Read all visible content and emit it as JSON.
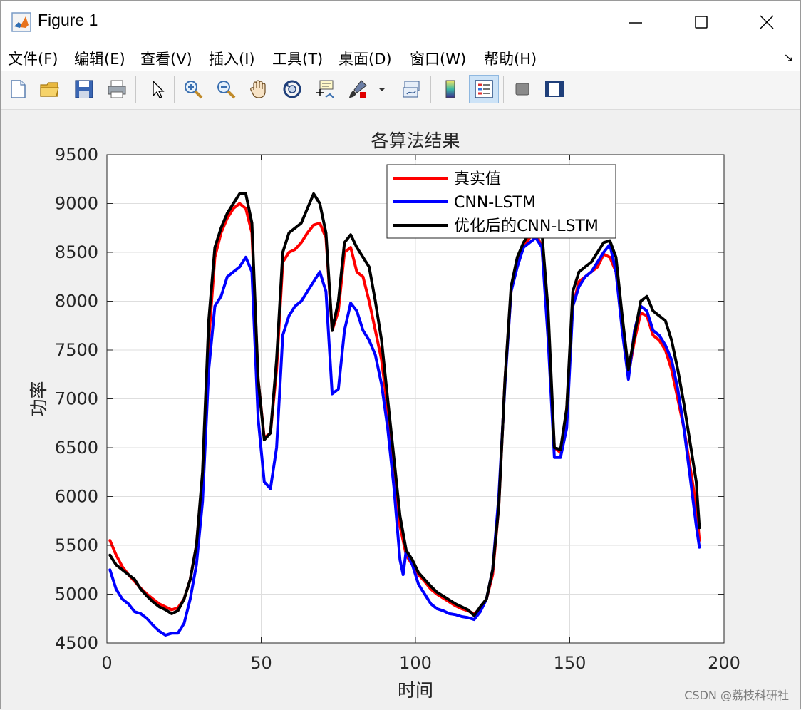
{
  "window": {
    "title": "Figure 1",
    "minimize_glyph": "—",
    "maximize_glyph": "☐",
    "close_glyph": "✕"
  },
  "menu": {
    "items": [
      "文件(F)",
      "编辑(E)",
      "查看(V)",
      "插入(I)",
      "工具(T)",
      "桌面(D)",
      "窗口(W)",
      "帮助(H)"
    ],
    "dock_arrow": "↘"
  },
  "toolbar": {
    "buttons": [
      "new-figure-icon",
      "open-folder-icon",
      "save-icon",
      "print-icon",
      "pointer-arrow-icon",
      "zoom-in-icon",
      "zoom-out-icon",
      "pan-hand-icon",
      "rotate-3d-icon",
      "data-cursor-icon",
      "brush-icon",
      "link-plot-icon",
      "colorbar-icon",
      "legend-icon",
      "hide-plot-tools-icon",
      "show-plot-tools-icon"
    ],
    "active": "legend-icon"
  },
  "watermark": "CSDN @荔枝科研社",
  "chart_data": {
    "type": "line",
    "title": "各算法结果",
    "xlabel": "时间",
    "ylabel": "功率",
    "xlim": [
      0,
      200
    ],
    "ylim": [
      4500,
      9500
    ],
    "xticks": [
      0,
      50,
      100,
      150,
      200
    ],
    "yticks": [
      4500,
      5000,
      5500,
      6000,
      6500,
      7000,
      7500,
      8000,
      8500,
      9000,
      9500
    ],
    "grid": true,
    "legend_position": "top-right",
    "series": [
      {
        "name": "真实值",
        "color": "#ff0000",
        "x": [
          1,
          3,
          5,
          7,
          9,
          11,
          13,
          15,
          17,
          19,
          21,
          23,
          25,
          27,
          29,
          31,
          33,
          35,
          37,
          39,
          41,
          43,
          45,
          47,
          49,
          51,
          53,
          55,
          57,
          59,
          61,
          63,
          65,
          67,
          69,
          71,
          73,
          75,
          77,
          79,
          81,
          83,
          85,
          87,
          89,
          91,
          93,
          95,
          97,
          99,
          101,
          103,
          105,
          107,
          109,
          111,
          113,
          115,
          117,
          119,
          121,
          123,
          125,
          127,
          129,
          131,
          133,
          135,
          137,
          139,
          141,
          143,
          145,
          147,
          149,
          151,
          153,
          155,
          157,
          159,
          161,
          163,
          165,
          167,
          169,
          171,
          173,
          175,
          177,
          179,
          181,
          183,
          185,
          187,
          189,
          191,
          192
        ],
        "y": [
          5550,
          5400,
          5280,
          5200,
          5130,
          5060,
          5000,
          4950,
          4900,
          4870,
          4840,
          4860,
          4950,
          5150,
          5500,
          6200,
          7600,
          8450,
          8700,
          8850,
          8950,
          9000,
          8950,
          8700,
          7200,
          6600,
          6650,
          7300,
          8400,
          8500,
          8530,
          8600,
          8700,
          8780,
          8800,
          8650,
          7700,
          7900,
          8500,
          8550,
          8300,
          8250,
          8000,
          7700,
          7400,
          6900,
          6300,
          5700,
          5400,
          5300,
          5200,
          5130,
          5050,
          5000,
          4960,
          4920,
          4880,
          4850,
          4830,
          4800,
          4850,
          4950,
          5200,
          5900,
          7200,
          8100,
          8400,
          8550,
          8650,
          8700,
          8550,
          7700,
          6500,
          6450,
          6900,
          7950,
          8200,
          8250,
          8300,
          8350,
          8480,
          8450,
          8300,
          7800,
          7250,
          7600,
          7880,
          7850,
          7650,
          7600,
          7500,
          7300,
          7000,
          6700,
          6300,
          5900,
          5550
        ]
      },
      {
        "name": "CNN-LSTM",
        "color": "#0000ff",
        "x": [
          1,
          3,
          5,
          7,
          9,
          11,
          13,
          15,
          17,
          19,
          21,
          23,
          25,
          27,
          29,
          31,
          33,
          35,
          37,
          39,
          41,
          43,
          45,
          47,
          49,
          51,
          53,
          55,
          57,
          59,
          61,
          63,
          65,
          67,
          69,
          71,
          73,
          75,
          77,
          79,
          81,
          83,
          85,
          87,
          89,
          91,
          93,
          95,
          96,
          97,
          99,
          101,
          103,
          105,
          107,
          109,
          111,
          113,
          115,
          117,
          119,
          121,
          123,
          125,
          127,
          129,
          131,
          133,
          135,
          137,
          139,
          141,
          143,
          145,
          147,
          149,
          151,
          153,
          155,
          157,
          159,
          161,
          163,
          165,
          167,
          169,
          171,
          173,
          175,
          177,
          179,
          181,
          183,
          185,
          187,
          189,
          191,
          192
        ],
        "y": [
          5250,
          5050,
          4950,
          4900,
          4820,
          4800,
          4750,
          4680,
          4620,
          4580,
          4600,
          4600,
          4700,
          4950,
          5300,
          5950,
          7300,
          7950,
          8050,
          8250,
          8300,
          8350,
          8450,
          8300,
          6800,
          6150,
          6080,
          6500,
          7650,
          7850,
          7950,
          8000,
          8100,
          8200,
          8300,
          8100,
          7050,
          7100,
          7700,
          7980,
          7900,
          7700,
          7600,
          7450,
          7150,
          6700,
          6100,
          5350,
          5200,
          5450,
          5300,
          5100,
          5000,
          4900,
          4850,
          4830,
          4800,
          4790,
          4770,
          4760,
          4740,
          4820,
          4950,
          5250,
          6000,
          7150,
          8100,
          8350,
          8550,
          8600,
          8650,
          8550,
          7600,
          6400,
          6400,
          6700,
          7950,
          8150,
          8250,
          8300,
          8400,
          8500,
          8580,
          8300,
          7700,
          7200,
          7700,
          7950,
          7900,
          7700,
          7650,
          7550,
          7400,
          7100,
          6700,
          6200,
          5700,
          5480
        ]
      },
      {
        "name": "优化后的CNN-LSTM",
        "color": "#000000",
        "x": [
          1,
          3,
          5,
          7,
          9,
          11,
          13,
          15,
          17,
          19,
          21,
          23,
          25,
          27,
          29,
          31,
          33,
          35,
          37,
          39,
          41,
          43,
          45,
          47,
          49,
          51,
          53,
          55,
          57,
          59,
          61,
          63,
          65,
          67,
          69,
          71,
          73,
          75,
          77,
          79,
          81,
          83,
          85,
          87,
          89,
          91,
          93,
          95,
          97,
          99,
          101,
          103,
          105,
          107,
          109,
          111,
          113,
          115,
          117,
          119,
          121,
          123,
          125,
          127,
          129,
          131,
          133,
          135,
          137,
          139,
          141,
          143,
          145,
          147,
          149,
          151,
          153,
          155,
          157,
          159,
          161,
          163,
          165,
          167,
          169,
          171,
          173,
          175,
          177,
          179,
          181,
          183,
          185,
          187,
          189,
          191,
          192
        ],
        "y": [
          5400,
          5300,
          5250,
          5200,
          5150,
          5050,
          4980,
          4920,
          4870,
          4840,
          4800,
          4830,
          4950,
          5150,
          5500,
          6250,
          7800,
          8550,
          8750,
          8900,
          9000,
          9100,
          9100,
          8800,
          7200,
          6580,
          6650,
          7400,
          8500,
          8700,
          8750,
          8800,
          8950,
          9100,
          9000,
          8700,
          7700,
          8000,
          8600,
          8680,
          8550,
          8450,
          8350,
          8000,
          7600,
          7000,
          6400,
          5800,
          5450,
          5350,
          5220,
          5150,
          5080,
          5020,
          4980,
          4940,
          4900,
          4870,
          4840,
          4780,
          4870,
          4950,
          5250,
          5900,
          7200,
          8150,
          8450,
          8600,
          8700,
          8780,
          8700,
          7900,
          6500,
          6480,
          6900,
          8100,
          8300,
          8350,
          8400,
          8500,
          8600,
          8620,
          8450,
          7850,
          7300,
          7650,
          8000,
          8050,
          7900,
          7850,
          7800,
          7600,
          7300,
          6950,
          6550,
          6150,
          5680
        ]
      }
    ]
  }
}
